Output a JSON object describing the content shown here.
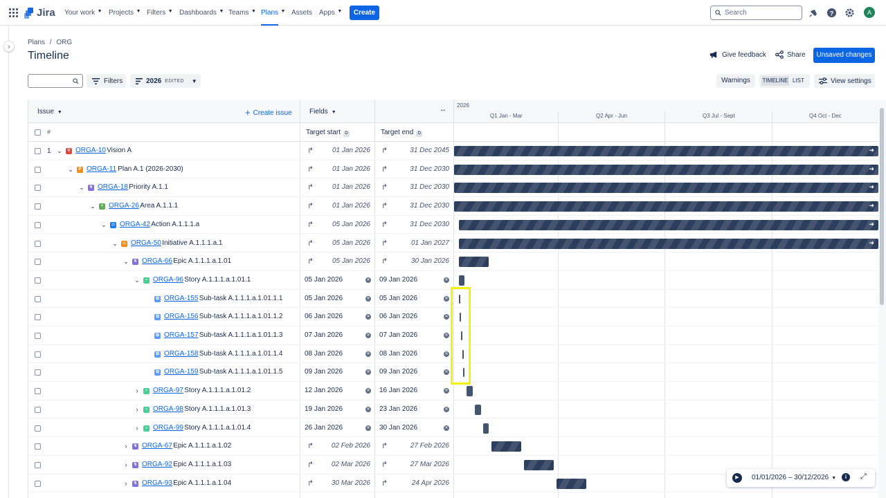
{
  "nav": {
    "logo": "Jira",
    "items": [
      "Your work",
      "Projects",
      "Filters",
      "Dashboards",
      "Teams",
      "Plans",
      "Assets",
      "Apps"
    ],
    "create": "Create",
    "search_placeholder": "Search",
    "avatar": "A"
  },
  "breadcrumb": [
    "Plans",
    "/",
    "ORG"
  ],
  "page_title": "Timeline",
  "actions": {
    "feedback": "Give feedback",
    "share": "Share",
    "unsaved": "Unsaved changes"
  },
  "toolbar": {
    "filters": "Filters",
    "scenario": "2026",
    "edited": "EDITED",
    "warnings": "Warnings",
    "timeline": "TIMELINE",
    "list": "LIST",
    "view_settings": "View settings"
  },
  "table": {
    "issue_header": "Issue",
    "create_issue": "Create issue",
    "fields": "Fields",
    "hash": "#",
    "target_start": "Target start",
    "target_end": "Target end",
    "d": "D",
    "year": "2026",
    "quarters": [
      "Q1 Jan - Mar",
      "Q2 Apr - Jun",
      "Q3 Jul - Sept",
      "Q4 Oct - Dec"
    ]
  },
  "rows": [
    {
      "num": "1",
      "key": "ORGA-10",
      "summary": "Vision A",
      "start": "01 Jan 2026",
      "end": "31 Dec 2045",
      "type": "vision",
      "rolled": true
    },
    {
      "num": "",
      "key": "ORGA-11",
      "summary": "Plan A.1 (2026-2030)",
      "start": "01 Jan 2026",
      "end": "31 Dec 2030",
      "type": "plan",
      "rolled": true
    },
    {
      "num": "",
      "key": "ORGA-18",
      "summary": "Priority A.1.1",
      "start": "01 Jan 2026",
      "end": "31 Dec 2030",
      "type": "priority",
      "rolled": true
    },
    {
      "num": "",
      "key": "ORGA-26",
      "summary": "Area A.1.1.1",
      "start": "01 Jan 2026",
      "end": "31 Dec 2030",
      "type": "area",
      "rolled": true
    },
    {
      "num": "",
      "key": "ORGA-42",
      "summary": "Action A.1.1.1.a",
      "start": "05 Jan 2026",
      "end": "31 Dec 2030",
      "type": "action",
      "rolled": true
    },
    {
      "num": "",
      "key": "ORGA-50",
      "summary": "Initiative A.1.1.1.a.1",
      "start": "05 Jan 2026",
      "end": "01 Jan 2027",
      "type": "initiative",
      "rolled": true
    },
    {
      "num": "",
      "key": "ORGA-66",
      "summary": "Epic A.1.1.1.a.1.01",
      "start": "05 Jan 2026",
      "end": "30 Jan 2026",
      "type": "epic",
      "rolled": true
    },
    {
      "num": "",
      "key": "ORGA-96",
      "summary": "Story A.1.1.1.a.1.01.1",
      "start": "05 Jan 2026",
      "end": "09 Jan 2026",
      "type": "story",
      "rolled": false
    },
    {
      "num": "",
      "key": "ORGA-155",
      "summary": "Sub-task A.1.1.1.a.1.01.1.1",
      "start": "05 Jan 2026",
      "end": "05 Jan 2026",
      "type": "subtask",
      "rolled": false
    },
    {
      "num": "",
      "key": "ORGA-156",
      "summary": "Sub-task A.1.1.1.a.1.01.1.2",
      "start": "06 Jan 2026",
      "end": "06 Jan 2026",
      "type": "subtask",
      "rolled": false
    },
    {
      "num": "",
      "key": "ORGA-157",
      "summary": "Sub-task A.1.1.1.a.1.01.1.3",
      "start": "07 Jan 2026",
      "end": "07 Jan 2026",
      "type": "subtask",
      "rolled": false
    },
    {
      "num": "",
      "key": "ORGA-158",
      "summary": "Sub-task A.1.1.1.a.1.01.1.4",
      "start": "08 Jan 2026",
      "end": "08 Jan 2026",
      "type": "subtask",
      "rolled": false
    },
    {
      "num": "",
      "key": "ORGA-159",
      "summary": "Sub-task A.1.1.1.a.1.01.1.5",
      "start": "09 Jan 2026",
      "end": "09 Jan 2026",
      "type": "subtask",
      "rolled": false
    },
    {
      "num": "",
      "key": "ORGA-97",
      "summary": "Story A.1.1.1.a.1.01.2",
      "start": "12 Jan 2026",
      "end": "16 Jan 2026",
      "type": "story",
      "rolled": false
    },
    {
      "num": "",
      "key": "ORGA-98",
      "summary": "Story A.1.1.1.a.1.01.3",
      "start": "19 Jan 2026",
      "end": "23 Jan 2026",
      "type": "story",
      "rolled": false
    },
    {
      "num": "",
      "key": "ORGA-99",
      "summary": "Story A.1.1.1.a.1.01.4",
      "start": "26 Jan 2026",
      "end": "30 Jan 2026",
      "type": "story",
      "rolled": false
    },
    {
      "num": "",
      "key": "ORGA-67",
      "summary": "Epic A.1.1.1.a.1.02",
      "start": "02 Feb 2026",
      "end": "27 Feb 2026",
      "type": "epic",
      "rolled": true
    },
    {
      "num": "",
      "key": "ORGA-92",
      "summary": "Epic A.1.1.1.a.1.03",
      "start": "02 Mar 2026",
      "end": "27 Mar 2026",
      "type": "epic",
      "rolled": true
    },
    {
      "num": "",
      "key": "ORGA-93",
      "summary": "Epic A.1.1.1.a.1.04",
      "start": "30 Mar 2026",
      "end": "24 Apr 2026",
      "type": "epic",
      "rolled": true
    }
  ],
  "date_range": "01/01/2026 – 30/12/2026",
  "colors": {
    "vision": "#e2483d",
    "plan": "#f18d13",
    "priority": "#8270db",
    "area": "#5fad56",
    "action": "#1d7afc",
    "initiative": "#f18d13",
    "epic": "#8270db",
    "story": "#4bce97",
    "subtask": "#579dff",
    "accent": "#0c66e4",
    "highlight": "#f2f20a"
  }
}
